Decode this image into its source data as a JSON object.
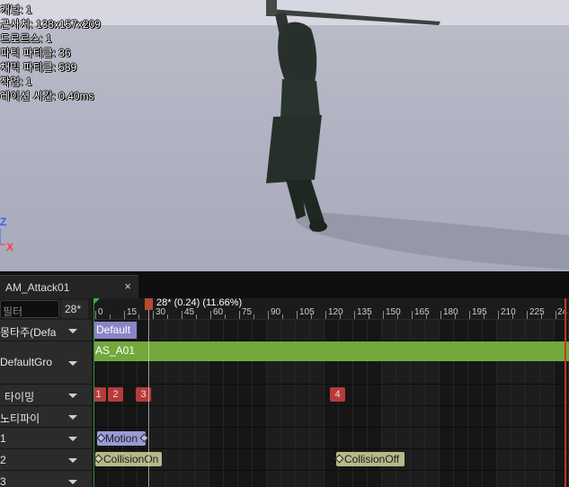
{
  "viewport": {
    "stats": [
      "캐널: 1",
      "근사치: 138x157x209",
      "드로르스: 1",
      "파틱 파티클: 36",
      "채믹 파티클: 589",
      "작업: 1",
      "레이션 시간: 0.40ms"
    ],
    "axis": {
      "z": "Z",
      "x": "X",
      "z_color": "#3b5bff",
      "x_color": "#ff3b3b"
    }
  },
  "tab": {
    "title": "AM_Attack01",
    "close": "×"
  },
  "filter": {
    "placeholder": "필터",
    "frame": "28*"
  },
  "tracks": [
    {
      "label": "몽타주(Defa"
    },
    {
      "label": "DefaultGro"
    },
    {
      "label": "타이밍"
    },
    {
      "label": "노티파이"
    },
    {
      "label": "1"
    },
    {
      "label": "2"
    },
    {
      "label": "3"
    }
  ],
  "ruler": {
    "labels": [
      "0",
      "15",
      "30",
      "45",
      "60",
      "75",
      "90",
      "105",
      "120",
      "135",
      "150",
      "165",
      "180",
      "195",
      "210",
      "225",
      "24"
    ],
    "playhead": "28* (0.24) (11.66%)"
  },
  "montage": {
    "section": "Default",
    "segment": "AS_A01",
    "section_color": "#8a86c5",
    "segment_color": "#72a83c"
  },
  "timing_markers": [
    "1",
    "2",
    "3",
    "4"
  ],
  "notifies": {
    "motion": "Motion",
    "collision_on": "CollisionOn",
    "collision_off": "CollisionOff",
    "motion_color": "#9a9bd6",
    "collision_color": "#b7b98a"
  }
}
